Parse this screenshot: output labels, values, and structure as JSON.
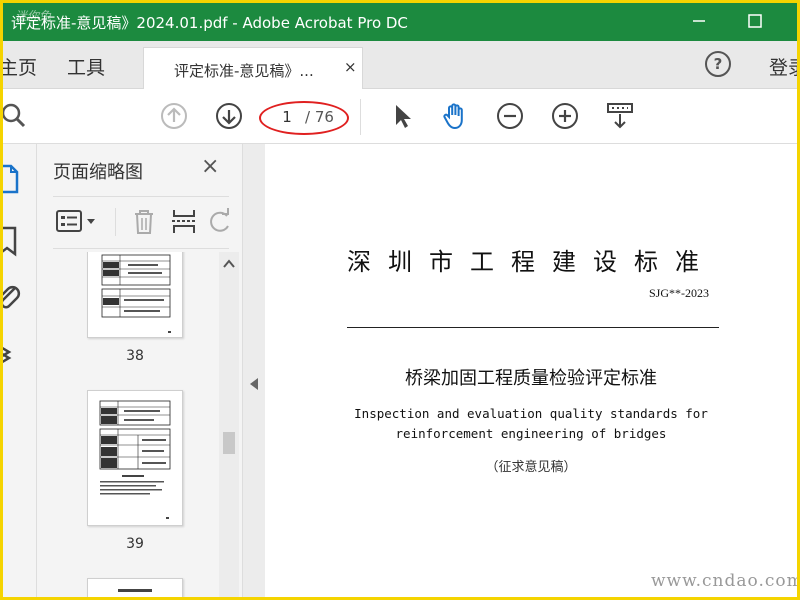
{
  "window": {
    "title": "评定标准-意见稿》2024.01.pdf - Adobe Acrobat Pro DC",
    "watermark_logo": "迷你兔"
  },
  "tabs": {
    "home": "主页",
    "tools": "工具",
    "document": "评定标准-意见稿》...",
    "document_close": "×",
    "help": "?",
    "signin": "登录"
  },
  "toolbar": {
    "current_page": "1",
    "total_pages": "/ 76",
    "icons": [
      "search-icon",
      "page-up-icon",
      "page-down-icon",
      "select-cursor-icon",
      "hand-tool-icon",
      "zoom-out-icon",
      "zoom-in-icon",
      "scroll-mode-icon"
    ]
  },
  "panel": {
    "title": "页面缩略图",
    "close": "×",
    "thumbnails": [
      {
        "page": "38"
      },
      {
        "page": "39"
      }
    ]
  },
  "document": {
    "standard_heading": "深圳市工程建设标准",
    "code": "SJG**-2023",
    "title_cn": "桥梁加固工程质量检验评定标准",
    "title_en_line1": "Inspection and evaluation quality standards for",
    "title_en_line2": "reinforcement engineering of bridges",
    "draft": "（征求意见稿）"
  },
  "site_watermark": "www.cndao.com",
  "colors": {
    "titlebar": "#1c8a3f",
    "border": "#f5d400",
    "hand_tool": "#1a73c9",
    "annotation": "#e02020"
  }
}
